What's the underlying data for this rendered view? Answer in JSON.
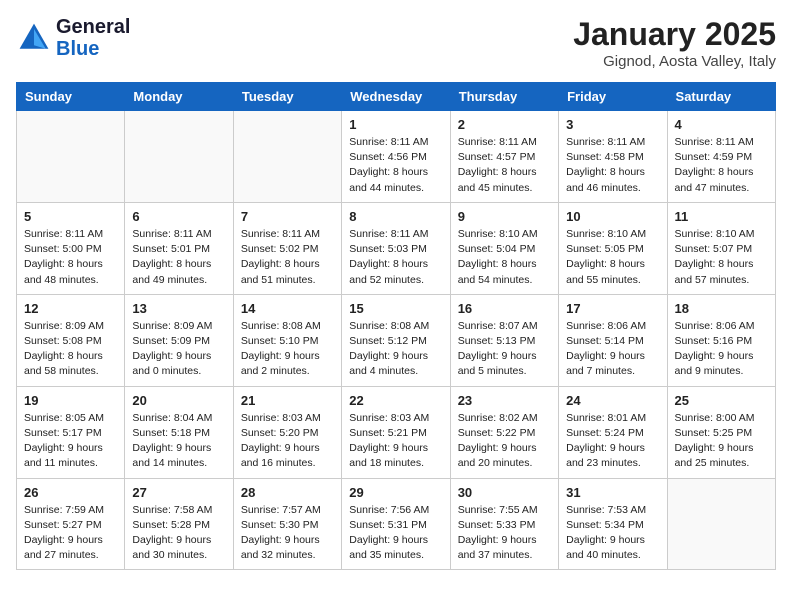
{
  "header": {
    "logo_line1": "General",
    "logo_line2": "Blue",
    "month_title": "January 2025",
    "location": "Gignod, Aosta Valley, Italy"
  },
  "weekdays": [
    "Sunday",
    "Monday",
    "Tuesday",
    "Wednesday",
    "Thursday",
    "Friday",
    "Saturday"
  ],
  "weeks": [
    [
      {
        "day": "",
        "info": ""
      },
      {
        "day": "",
        "info": ""
      },
      {
        "day": "",
        "info": ""
      },
      {
        "day": "1",
        "info": "Sunrise: 8:11 AM\nSunset: 4:56 PM\nDaylight: 8 hours\nand 44 minutes."
      },
      {
        "day": "2",
        "info": "Sunrise: 8:11 AM\nSunset: 4:57 PM\nDaylight: 8 hours\nand 45 minutes."
      },
      {
        "day": "3",
        "info": "Sunrise: 8:11 AM\nSunset: 4:58 PM\nDaylight: 8 hours\nand 46 minutes."
      },
      {
        "day": "4",
        "info": "Sunrise: 8:11 AM\nSunset: 4:59 PM\nDaylight: 8 hours\nand 47 minutes."
      }
    ],
    [
      {
        "day": "5",
        "info": "Sunrise: 8:11 AM\nSunset: 5:00 PM\nDaylight: 8 hours\nand 48 minutes."
      },
      {
        "day": "6",
        "info": "Sunrise: 8:11 AM\nSunset: 5:01 PM\nDaylight: 8 hours\nand 49 minutes."
      },
      {
        "day": "7",
        "info": "Sunrise: 8:11 AM\nSunset: 5:02 PM\nDaylight: 8 hours\nand 51 minutes."
      },
      {
        "day": "8",
        "info": "Sunrise: 8:11 AM\nSunset: 5:03 PM\nDaylight: 8 hours\nand 52 minutes."
      },
      {
        "day": "9",
        "info": "Sunrise: 8:10 AM\nSunset: 5:04 PM\nDaylight: 8 hours\nand 54 minutes."
      },
      {
        "day": "10",
        "info": "Sunrise: 8:10 AM\nSunset: 5:05 PM\nDaylight: 8 hours\nand 55 minutes."
      },
      {
        "day": "11",
        "info": "Sunrise: 8:10 AM\nSunset: 5:07 PM\nDaylight: 8 hours\nand 57 minutes."
      }
    ],
    [
      {
        "day": "12",
        "info": "Sunrise: 8:09 AM\nSunset: 5:08 PM\nDaylight: 8 hours\nand 58 minutes."
      },
      {
        "day": "13",
        "info": "Sunrise: 8:09 AM\nSunset: 5:09 PM\nDaylight: 9 hours\nand 0 minutes."
      },
      {
        "day": "14",
        "info": "Sunrise: 8:08 AM\nSunset: 5:10 PM\nDaylight: 9 hours\nand 2 minutes."
      },
      {
        "day": "15",
        "info": "Sunrise: 8:08 AM\nSunset: 5:12 PM\nDaylight: 9 hours\nand 4 minutes."
      },
      {
        "day": "16",
        "info": "Sunrise: 8:07 AM\nSunset: 5:13 PM\nDaylight: 9 hours\nand 5 minutes."
      },
      {
        "day": "17",
        "info": "Sunrise: 8:06 AM\nSunset: 5:14 PM\nDaylight: 9 hours\nand 7 minutes."
      },
      {
        "day": "18",
        "info": "Sunrise: 8:06 AM\nSunset: 5:16 PM\nDaylight: 9 hours\nand 9 minutes."
      }
    ],
    [
      {
        "day": "19",
        "info": "Sunrise: 8:05 AM\nSunset: 5:17 PM\nDaylight: 9 hours\nand 11 minutes."
      },
      {
        "day": "20",
        "info": "Sunrise: 8:04 AM\nSunset: 5:18 PM\nDaylight: 9 hours\nand 14 minutes."
      },
      {
        "day": "21",
        "info": "Sunrise: 8:03 AM\nSunset: 5:20 PM\nDaylight: 9 hours\nand 16 minutes."
      },
      {
        "day": "22",
        "info": "Sunrise: 8:03 AM\nSunset: 5:21 PM\nDaylight: 9 hours\nand 18 minutes."
      },
      {
        "day": "23",
        "info": "Sunrise: 8:02 AM\nSunset: 5:22 PM\nDaylight: 9 hours\nand 20 minutes."
      },
      {
        "day": "24",
        "info": "Sunrise: 8:01 AM\nSunset: 5:24 PM\nDaylight: 9 hours\nand 23 minutes."
      },
      {
        "day": "25",
        "info": "Sunrise: 8:00 AM\nSunset: 5:25 PM\nDaylight: 9 hours\nand 25 minutes."
      }
    ],
    [
      {
        "day": "26",
        "info": "Sunrise: 7:59 AM\nSunset: 5:27 PM\nDaylight: 9 hours\nand 27 minutes."
      },
      {
        "day": "27",
        "info": "Sunrise: 7:58 AM\nSunset: 5:28 PM\nDaylight: 9 hours\nand 30 minutes."
      },
      {
        "day": "28",
        "info": "Sunrise: 7:57 AM\nSunset: 5:30 PM\nDaylight: 9 hours\nand 32 minutes."
      },
      {
        "day": "29",
        "info": "Sunrise: 7:56 AM\nSunset: 5:31 PM\nDaylight: 9 hours\nand 35 minutes."
      },
      {
        "day": "30",
        "info": "Sunrise: 7:55 AM\nSunset: 5:33 PM\nDaylight: 9 hours\nand 37 minutes."
      },
      {
        "day": "31",
        "info": "Sunrise: 7:53 AM\nSunset: 5:34 PM\nDaylight: 9 hours\nand 40 minutes."
      },
      {
        "day": "",
        "info": ""
      }
    ]
  ]
}
